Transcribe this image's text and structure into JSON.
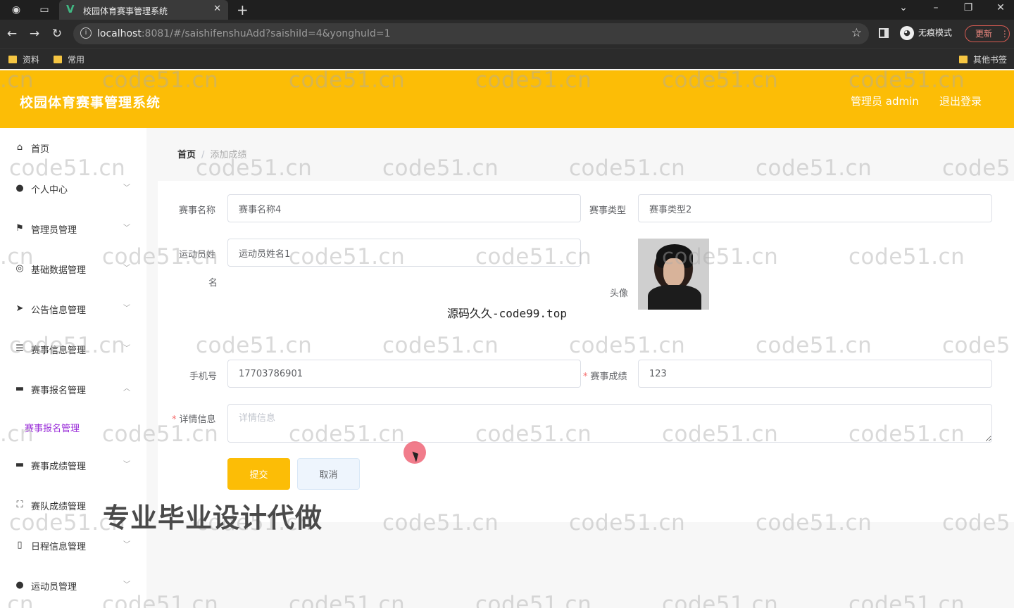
{
  "browser": {
    "tab_title": "校园体育赛事管理系统",
    "url_host": "localhost",
    "url_path": ":8081/#/saishifenshuAdd?saishiId=4&yonghuId=1",
    "incognito_label": "无痕模式",
    "update_label": "更新",
    "bookmarks": [
      "资料",
      "常用"
    ],
    "other_bookmarks": "其他书签"
  },
  "header": {
    "title": "校园体育赛事管理系统",
    "user": "管理员 admin",
    "logout": "退出登录"
  },
  "sidebar": {
    "items": [
      {
        "label": "首页",
        "icon": "home-icon"
      },
      {
        "label": "个人中心",
        "icon": "user-icon"
      },
      {
        "label": "管理员管理",
        "icon": "flag-icon"
      },
      {
        "label": "基础数据管理",
        "icon": "settings-icon"
      },
      {
        "label": "公告信息管理",
        "icon": "send-icon"
      },
      {
        "label": "赛事信息管理",
        "icon": "list-icon"
      },
      {
        "label": "赛事报名管理",
        "icon": "monitor-icon"
      },
      {
        "label": "赛事成绩管理",
        "icon": "monitor-icon"
      },
      {
        "label": "赛队成绩管理",
        "icon": "fullscreen-icon"
      },
      {
        "label": "日程信息管理",
        "icon": "phone-icon"
      },
      {
        "label": "运动员管理",
        "icon": "pin-icon"
      }
    ],
    "subitem": "赛事报名管理"
  },
  "breadcrumb": {
    "home": "首页",
    "separator": "/",
    "current": "添加成绩"
  },
  "form": {
    "event_name_label": "赛事名称",
    "event_name_value": "赛事名称4",
    "event_type_label": "赛事类型",
    "event_type_value": "赛事类型2",
    "athlete_name_label_1": "运动员姓",
    "athlete_name_label_2": "名",
    "athlete_name_value": "运动员姓名1",
    "avatar_label": "头像",
    "phone_label": "手机号",
    "phone_value": "17703786901",
    "score_label": "赛事成绩",
    "score_value": "123",
    "detail_label": "详情信息",
    "detail_placeholder": "详情信息",
    "required_mark": "*",
    "submit": "提交",
    "cancel": "取消"
  },
  "overlays": {
    "watermark": "code51.cn",
    "watermark_partial_left": ".cn",
    "watermark_partial_right": "code5",
    "code99": "源码久久-code99.top",
    "promo": "专业毕业设计代做"
  }
}
